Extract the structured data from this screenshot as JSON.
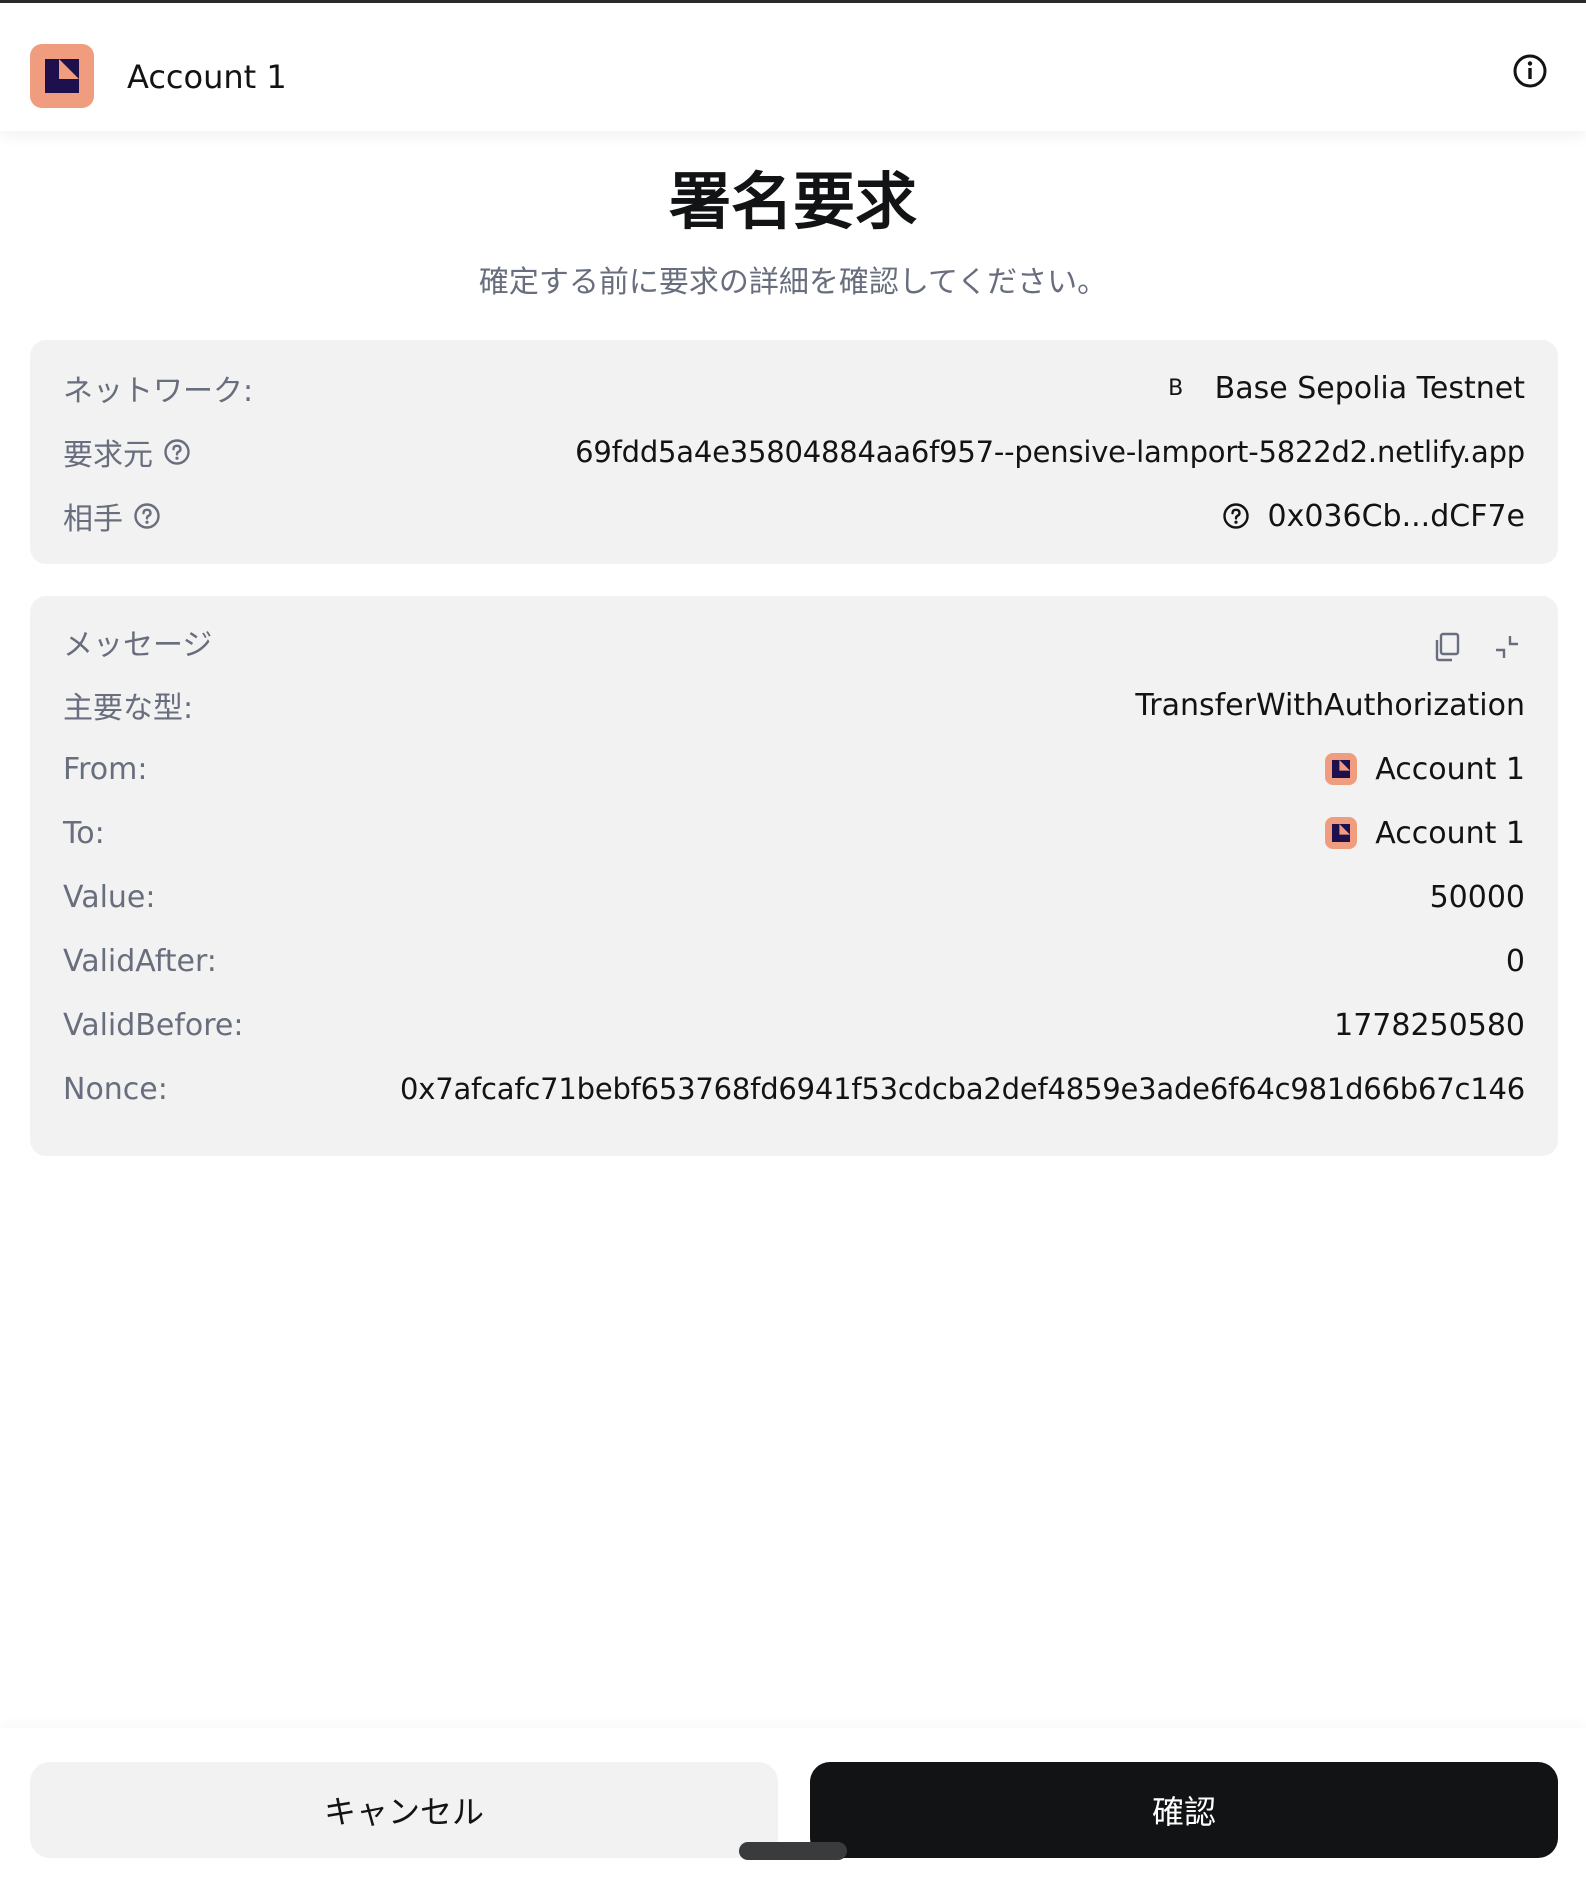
{
  "header": {
    "account_name": "Account 1",
    "avatar_color": "#ef9d7e",
    "avatar_icon": "fox-logo-icon",
    "info_icon": "info-icon"
  },
  "title": "署名要求",
  "subtitle": "確定する前に要求の詳細を確認してください。",
  "details": {
    "network_label": "ネットワーク:",
    "network_letter": "B",
    "network_value": "Base Sepolia Testnet",
    "origin_label": "要求元",
    "origin_value": "69fdd5a4e35804884aa6f957--pensive-lamport-5822d2.netlify.app",
    "counterparty_label": "相手",
    "counterparty_value": "0x036Cb...dCF7e"
  },
  "message": {
    "section_label": "メッセージ",
    "primary_type_label": "主要な型:",
    "primary_type_value": "TransferWithAuthorization",
    "from_label": "From:",
    "from_value": "Account 1",
    "to_label": "To:",
    "to_value": "Account 1",
    "value_label": "Value:",
    "value_value": "50000",
    "valid_after_label": "ValidAfter:",
    "valid_after_value": "0",
    "valid_before_label": "ValidBefore:",
    "valid_before_value": "1778250580",
    "nonce_label": "Nonce:",
    "nonce_value": "0x7afcafc71bebf653768fd6941f53cdcba2def4859e3ade6f64c981d66b67c146"
  },
  "footer": {
    "cancel_label": "キャンセル",
    "confirm_label": "確認"
  },
  "colors": {
    "card_bg": "#f2f2f2",
    "primary_dark": "#121314",
    "muted_text": "#686e7d"
  }
}
